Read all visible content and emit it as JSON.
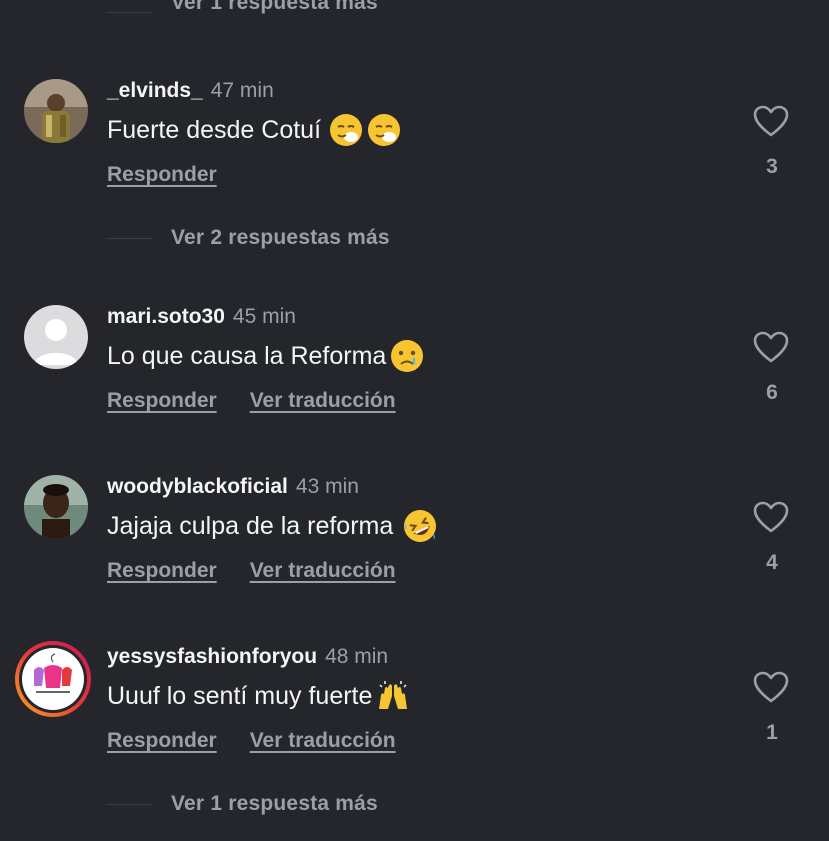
{
  "more_replies_top": {
    "label": "Ver 1 respuesta más"
  },
  "more_replies_1": {
    "label": "Ver 2 respuestas más"
  },
  "more_replies_bottom": {
    "label": "Ver 1 respuesta más"
  },
  "comments": [
    {
      "username": "_elvinds_",
      "time": "47 min",
      "text": "Fuerte desde Cotuí",
      "emojis": [
        "sneezing-face-emoji",
        "sneezing-face-emoji"
      ],
      "reply_label": "Responder",
      "likes": "3"
    },
    {
      "username": "mari.soto30",
      "time": "45 min",
      "text": "Lo que causa la Reforma",
      "emojis": [
        "crying-face-emoji"
      ],
      "reply_label": "Responder",
      "translate_label": "Ver traducción",
      "likes": "6"
    },
    {
      "username": "woodyblackoficial",
      "time": "43 min",
      "text": "Jajaja culpa de la reforma",
      "emojis": [
        "rofl-emoji"
      ],
      "reply_label": "Responder",
      "translate_label": "Ver traducción",
      "likes": "4"
    },
    {
      "username": "yessysfashionforyou",
      "time": "48 min",
      "text": "Uuuf lo sentí muy fuerte",
      "emojis": [
        "raising-hands-emoji"
      ],
      "reply_label": "Responder",
      "translate_label": "Ver traducción",
      "likes": "1"
    }
  ],
  "colors": {
    "background": "#24262b",
    "primary_text": "#f4f5f7",
    "secondary_text": "#9aa0a8",
    "story_ring_start": "#f9a825",
    "story_ring_end": "#c2185b"
  }
}
